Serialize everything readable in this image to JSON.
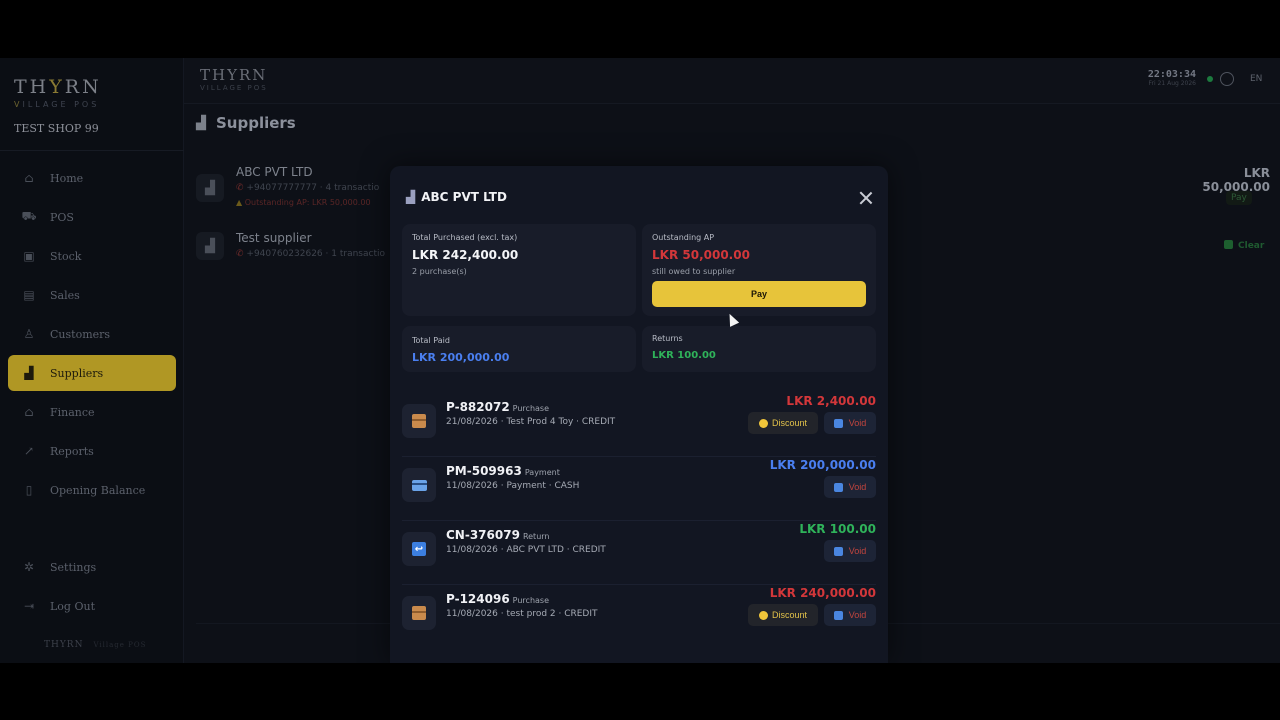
{
  "sidebar": {
    "brand_pre": "TH",
    "brand_y": "Y",
    "brand_post": "RN",
    "brand_sub_v": "V",
    "brand_sub_rest": "ILLAGE POS",
    "shop_name": "TEST SHOP 99",
    "items": [
      {
        "label": "Home",
        "icon": "home-icon"
      },
      {
        "label": "POS",
        "icon": "cart-icon"
      },
      {
        "label": "Stock",
        "icon": "box-icon"
      },
      {
        "label": "Sales",
        "icon": "receipt-icon"
      },
      {
        "label": "Customers",
        "icon": "user-icon"
      },
      {
        "label": "Suppliers",
        "icon": "factory-icon"
      },
      {
        "label": "Finance",
        "icon": "bank-icon"
      },
      {
        "label": "Reports",
        "icon": "chart-icon"
      },
      {
        "label": "Opening Balance",
        "icon": "book-icon"
      },
      {
        "label": "Settings",
        "icon": "gear-icon"
      },
      {
        "label": "Log Out",
        "icon": "logout-icon"
      }
    ],
    "footer": "THYRN",
    "footer_sub": "Village POS"
  },
  "topbar": {
    "logo": "THYRN",
    "logo_sub": "VILLAGE POS",
    "time": "22:03:34",
    "date": "Fri 21 Aug 2026",
    "lang": "EN"
  },
  "page": {
    "title": "Suppliers",
    "suppliers": [
      {
        "name": "ABC PVT LTD",
        "phone": "+94077777777",
        "meta": " · 4 transactio",
        "warning": "Outstanding AP: LKR 50,000.00",
        "amount": "LKR 50,000.00",
        "action": "Pay"
      },
      {
        "name": "Test supplier",
        "phone": "+940760232626",
        "meta": " · 1 transactio",
        "action": "Clear"
      }
    ]
  },
  "modal": {
    "title": "ABC PVT LTD",
    "total_purchased_label": "Total Purchased (excl. tax)",
    "total_purchased_value": "LKR 242,400.00",
    "total_purchased_sub": "2 purchase(s)",
    "outstanding_label": "Outstanding AP",
    "outstanding_value": "LKR 50,000.00",
    "outstanding_sub": "still owed to supplier",
    "pay_label": "Pay",
    "total_paid_label": "Total Paid",
    "total_paid_value": "LKR 200,000.00",
    "returns_label": "Returns",
    "returns_value": "LKR 100.00",
    "transactions": [
      {
        "id": "P-882072",
        "type": "Purchase",
        "detail": "21/08/2026 · Test Prod 4 Toy · CREDIT",
        "amount": "LKR 2,400.00",
        "kind": "purchase",
        "discount": "Discount",
        "void": "Void"
      },
      {
        "id": "PM-509963",
        "type": "Payment",
        "detail": "11/08/2026 · Payment · CASH",
        "amount": "LKR 200,000.00",
        "kind": "payment",
        "void": "Void"
      },
      {
        "id": "CN-376079",
        "type": "Return",
        "detail": "11/08/2026 · ABC PVT LTD · CREDIT",
        "amount": "LKR 100.00",
        "kind": "return",
        "void": "Void"
      },
      {
        "id": "P-124096",
        "type": "Purchase",
        "detail": "11/08/2026 · test prod 2 · CREDIT",
        "amount": "LKR 240,000.00",
        "kind": "purchase",
        "discount": "Discount",
        "void": "Void"
      }
    ]
  },
  "colors": {
    "accent": "#e7c43a",
    "negative": "#d3373a",
    "payment": "#4a7ff0",
    "positive": "#2fb35a"
  }
}
